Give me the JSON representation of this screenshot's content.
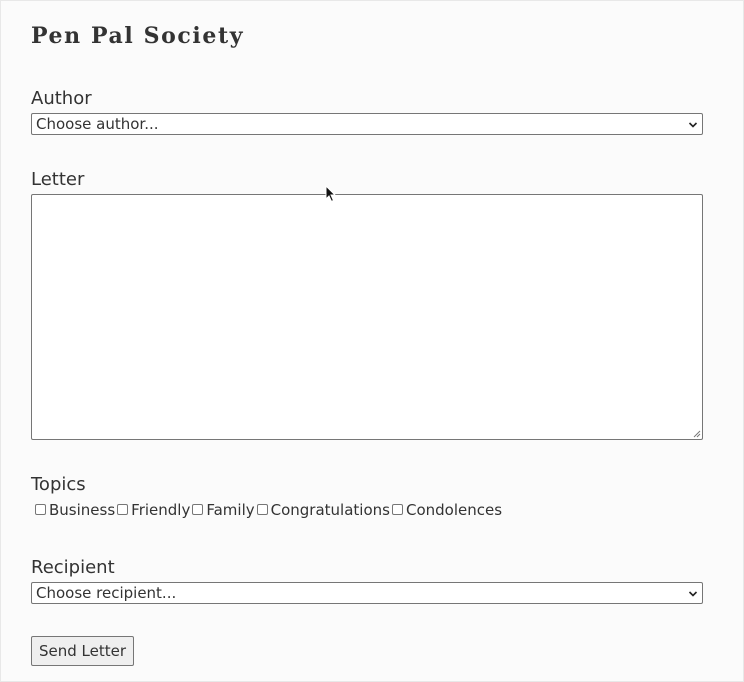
{
  "page": {
    "title": "Pen Pal Society"
  },
  "form": {
    "author": {
      "label": "Author",
      "selected": "Choose author..."
    },
    "letter": {
      "label": "Letter",
      "value": ""
    },
    "topics": {
      "label": "Topics",
      "options": [
        "Business",
        "Friendly",
        "Family",
        "Congratulations",
        "Condolences"
      ]
    },
    "recipient": {
      "label": "Recipient",
      "selected": "Choose recipient..."
    },
    "send_label": "Send Letter"
  },
  "icons": {
    "select_chevron": "chevron-down-icon",
    "resize": "resize-grip-icon",
    "cursor": "mouse-pointer-icon"
  }
}
